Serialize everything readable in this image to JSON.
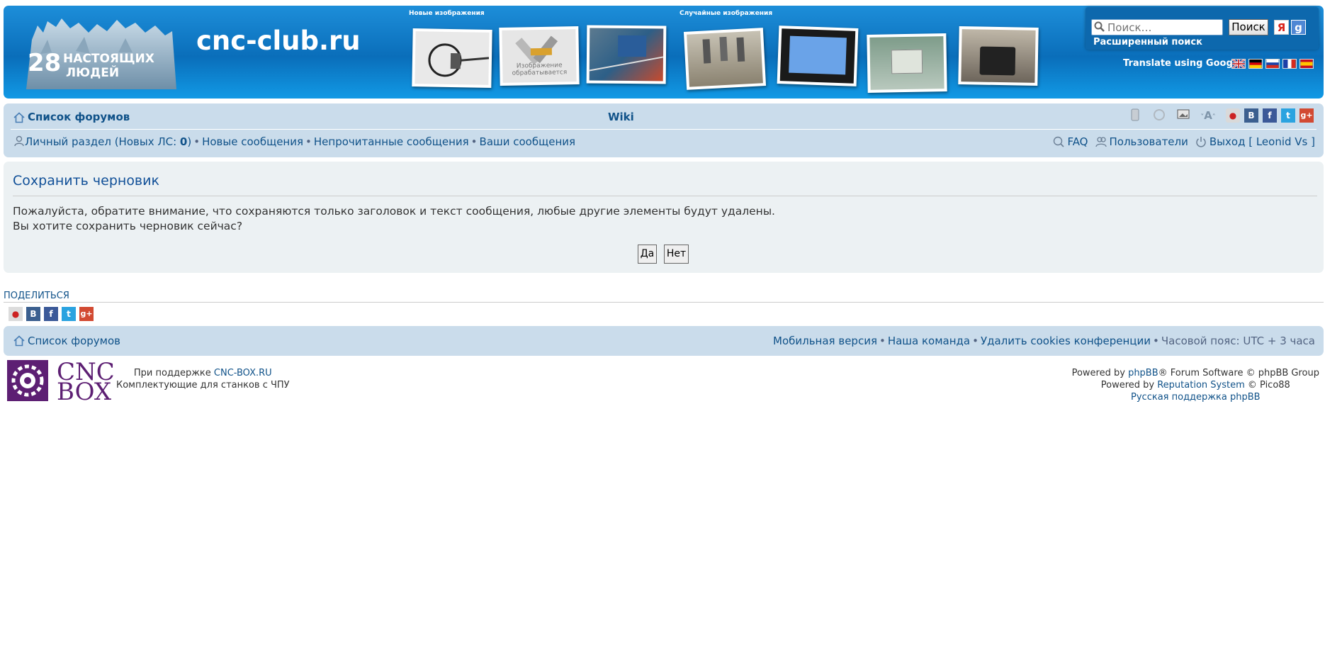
{
  "header": {
    "site_name": "cnc-club.ru",
    "logo_caption_number": "28",
    "logo_caption_line1": "НАСТОЯЩИХ",
    "logo_caption_line2": "ЛЮДЕЙ",
    "new_images_label": "Новые изображения",
    "random_images_label": "Случайные изображения",
    "processing_thumb_text": "Изображение обрабатывается"
  },
  "search": {
    "placeholder": "Поиск…",
    "button_label": "Поиск",
    "yandex_label": "Я",
    "google_label": "g",
    "advanced_label": "Расширенный поиск",
    "translate_label": "Translate using Google:"
  },
  "nav": {
    "forum_list": "Список форумов",
    "wiki": "Wiki",
    "font_size_label": "A",
    "vk_label": "В",
    "fb_label": "f",
    "tw_label": "t",
    "gp_label": "g+",
    "personal_prefix": "Личный раздел (Новых ЛС: ",
    "personal_count": "0",
    "personal_suffix": ")",
    "new_posts": "Новые сообщения",
    "unread_posts": "Непрочитанные сообщения",
    "your_posts": "Ваши сообщения",
    "faq": "FAQ",
    "users": "Пользователи",
    "logout": "Выход",
    "username": "Leonid Vs"
  },
  "dialog": {
    "title": "Сохранить черновик",
    "line1": "Пожалуйста, обратите внимание, что сохраняются только заголовок и текст сообщения, любые другие элементы будут удалены.",
    "line2": "Вы хотите сохранить черновик сейчас?",
    "yes_label": "Да",
    "no_label": "Нет"
  },
  "share": {
    "label": "ПОДЕЛИТЬСЯ"
  },
  "footer": {
    "forum_list": "Список форумов",
    "mobile": "Мобильная версия",
    "team": "Наша команда",
    "delete_cookies": "Удалить cookies конференции",
    "timezone": "Часовой пояс: UTC + 3 часа",
    "support_prefix": "При поддержке ",
    "support_link": "CNC-BOX.RU",
    "support_line2": "Комплектующие для станков с ЧПУ",
    "powered_prefix": "Powered by ",
    "phpbb_link": "phpBB",
    "powered_suffix": "® Forum Software © phpBB Group",
    "rep_prefix": "Powered by ",
    "rep_link": "Reputation System",
    "rep_suffix": " © Pico88",
    "russian_support": "Русская поддержка phpBB",
    "cnc_logo_line1": "CNC",
    "cnc_logo_line2": "BOX"
  },
  "colors": {
    "header_blue": "#0a6eba",
    "nav_bg": "#cadceb",
    "panel_bg": "#ecf1f3",
    "link": "#105289",
    "title": "#115098",
    "cnc_purple": "#5d1f73"
  }
}
